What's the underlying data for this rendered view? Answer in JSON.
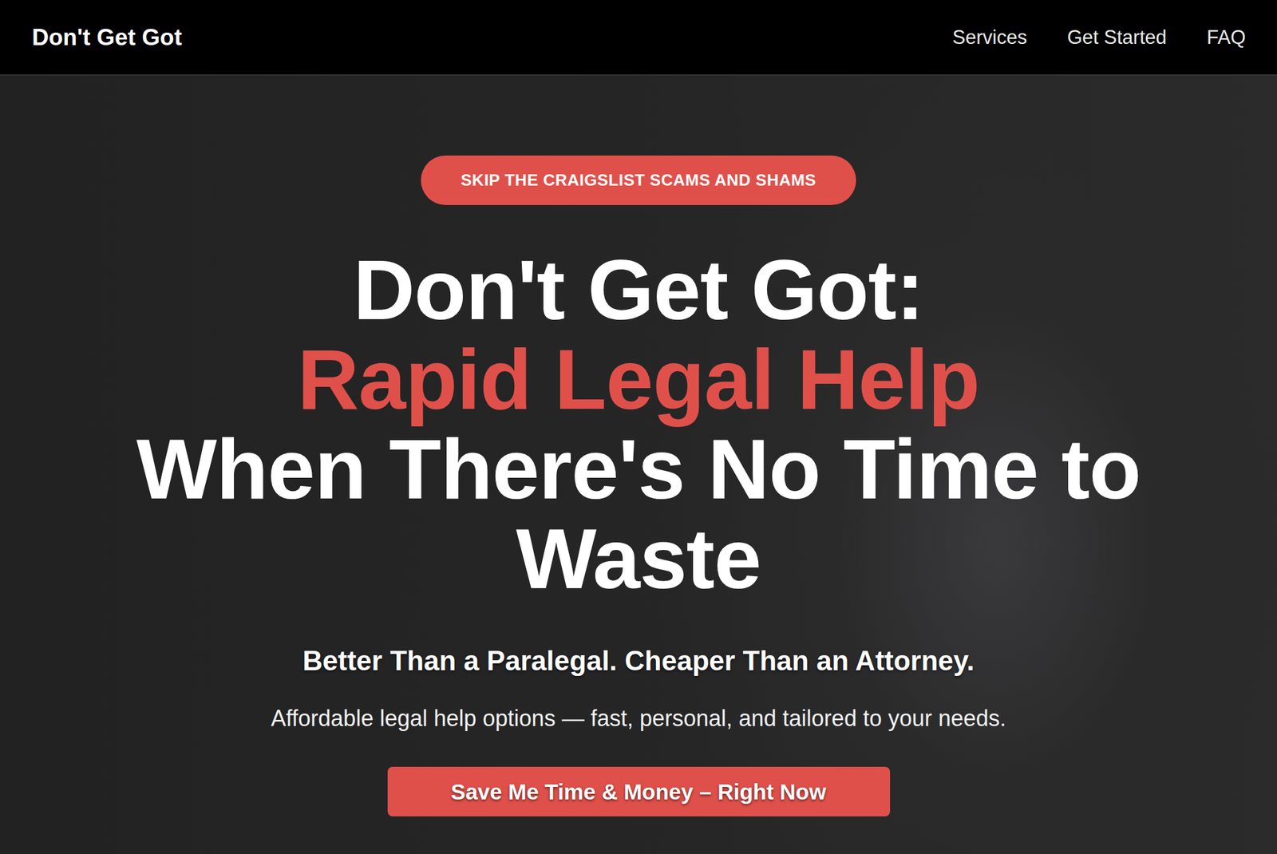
{
  "nav": {
    "logo": "Don't Get Got",
    "links": [
      "Services",
      "Get Started",
      "FAQ"
    ]
  },
  "hero": {
    "badge": "SKIP THE CRAIGSLIST SCAMS AND SHAMS",
    "headline": {
      "lead": "Don't Get Got:",
      "highlight": "Rapid Legal Help",
      "tail": "When There's No Time to Waste"
    },
    "subheading": "Better Than a Paralegal. Cheaper Than an Attorney.",
    "description": "Affordable legal help options — fast, personal, and tailored to your needs.",
    "cta": "Save Me Time & Money – Right Now"
  }
}
